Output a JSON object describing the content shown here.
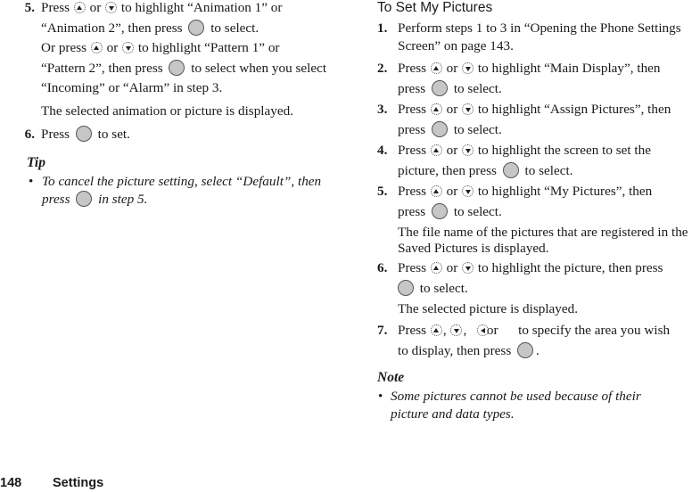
{
  "left": {
    "step5": {
      "num": "5.",
      "l1a": "Press",
      "l1b": "or",
      "l1c": "to highlight “Animation 1” or",
      "l2a": "“Animation 2”, then press",
      "l2b": "to select.",
      "l3a": "Or press",
      "l3b": "or",
      "l3c": "to highlight “Pattern 1” or",
      "l4a": "“Pattern 2”, then press",
      "l4b": "to select when you select",
      "l5": "“Incoming” or “Alarm” in step 3.",
      "sub": "The selected animation or picture is displayed."
    },
    "step6": {
      "num": "6.",
      "a": "Press",
      "b": "to set."
    },
    "tip": {
      "heading": "Tip",
      "bullet": "•",
      "l1": "To cancel the picture setting, select “Default”, then",
      "l2a": "press",
      "l2b": "in step 5."
    }
  },
  "right": {
    "heading": "To Set My Pictures",
    "steps": {
      "s1": {
        "num": "1.",
        "l1": "Perform steps 1 to 3 in “Opening the Phone Settings",
        "l2": "Screen” on page 143."
      },
      "s2": {
        "num": "2.",
        "a": "Press",
        "b": "or",
        "c": "to highlight “Main Display”, then",
        "d": "press",
        "e": "to select."
      },
      "s3": {
        "num": "3.",
        "a": "Press",
        "b": "or",
        "c": "to highlight “Assign Pictures”, then",
        "d": "press",
        "e": "to select."
      },
      "s4": {
        "num": "4.",
        "a": "Press",
        "b": "or",
        "c": "to highlight the screen to set the",
        "d": "picture, then press",
        "e": "to select."
      },
      "s5": {
        "num": "5.",
        "a": "Press",
        "b": "or",
        "c": "to highlight “My Pictures”, then",
        "d": "press",
        "e": "to select.",
        "sub": "The file name of the pictures that are registered in the Saved Pictures is displayed."
      },
      "s6": {
        "num": "6.",
        "a": "Press",
        "b": "or",
        "c": "to highlight the picture, then press",
        "e": "to select.",
        "sub": "The selected picture is displayed."
      },
      "s7": {
        "num": "7.",
        "a": "Press",
        "comma": ",",
        "b": "or",
        "c": "to specify the area you wish",
        "d": "to display, then press",
        "e": "."
      }
    },
    "note": {
      "heading": "Note",
      "bullet": "•",
      "l1": "Some pictures cannot be used because of their",
      "l2": "picture and data types."
    }
  },
  "footer": {
    "page_number": "148",
    "section": "Settings"
  }
}
